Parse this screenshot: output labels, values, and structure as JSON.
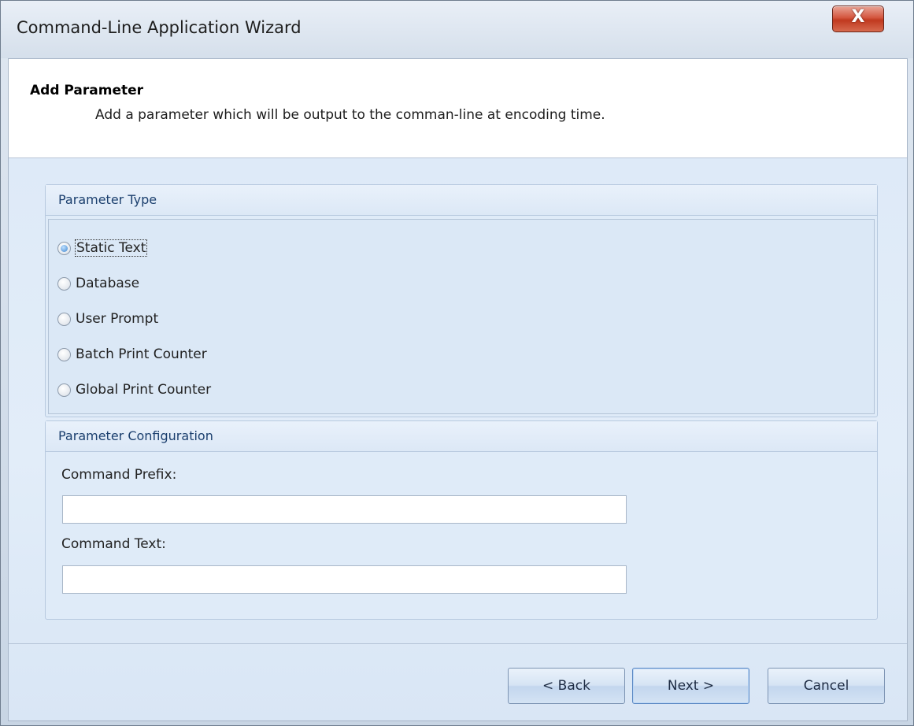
{
  "window": {
    "title": "Command-Line Application Wizard",
    "close_glyph": "X"
  },
  "header": {
    "title": "Add Parameter",
    "subtitle": "Add a parameter which will be output to the comman-line at encoding time."
  },
  "parameter_type": {
    "heading": "Parameter Type",
    "options": [
      {
        "label": "Static Text",
        "checked": true
      },
      {
        "label": "Database",
        "checked": false
      },
      {
        "label": "User Prompt",
        "checked": false
      },
      {
        "label": "Batch Print Counter",
        "checked": false
      },
      {
        "label": "Global Print Counter",
        "checked": false
      }
    ]
  },
  "parameter_configuration": {
    "heading": "Parameter Configuration",
    "command_prefix_label": "Command Prefix:",
    "command_prefix_value": "",
    "command_text_label": "Command Text:",
    "command_text_value": ""
  },
  "buttons": {
    "back": "< Back",
    "next": "Next >",
    "cancel": "Cancel"
  }
}
